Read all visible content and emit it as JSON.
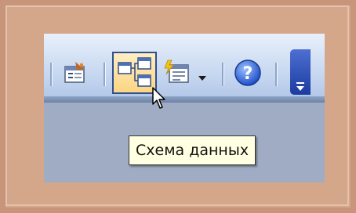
{
  "toolbar": {
    "buttons": [
      {
        "id": "properties",
        "icon": "properties-icon",
        "selected": false
      },
      {
        "id": "relationships",
        "icon": "relationships-icon",
        "selected": true
      },
      {
        "id": "new-object",
        "icon": "new-object-icon",
        "selected": false,
        "has_dropdown": true
      },
      {
        "id": "help",
        "icon": "help-icon",
        "selected": false
      }
    ],
    "help_label": "?",
    "colors": {
      "toolbar_top": "#e8f0fb",
      "toolbar_bottom": "#aec4e6",
      "selected_fill": "#fbd583",
      "selected_border": "#2f4f8f",
      "overflow": "#1c3c9f"
    }
  },
  "tooltip": {
    "text": "Схема данных"
  },
  "frame": {
    "background": "#d5a789"
  }
}
